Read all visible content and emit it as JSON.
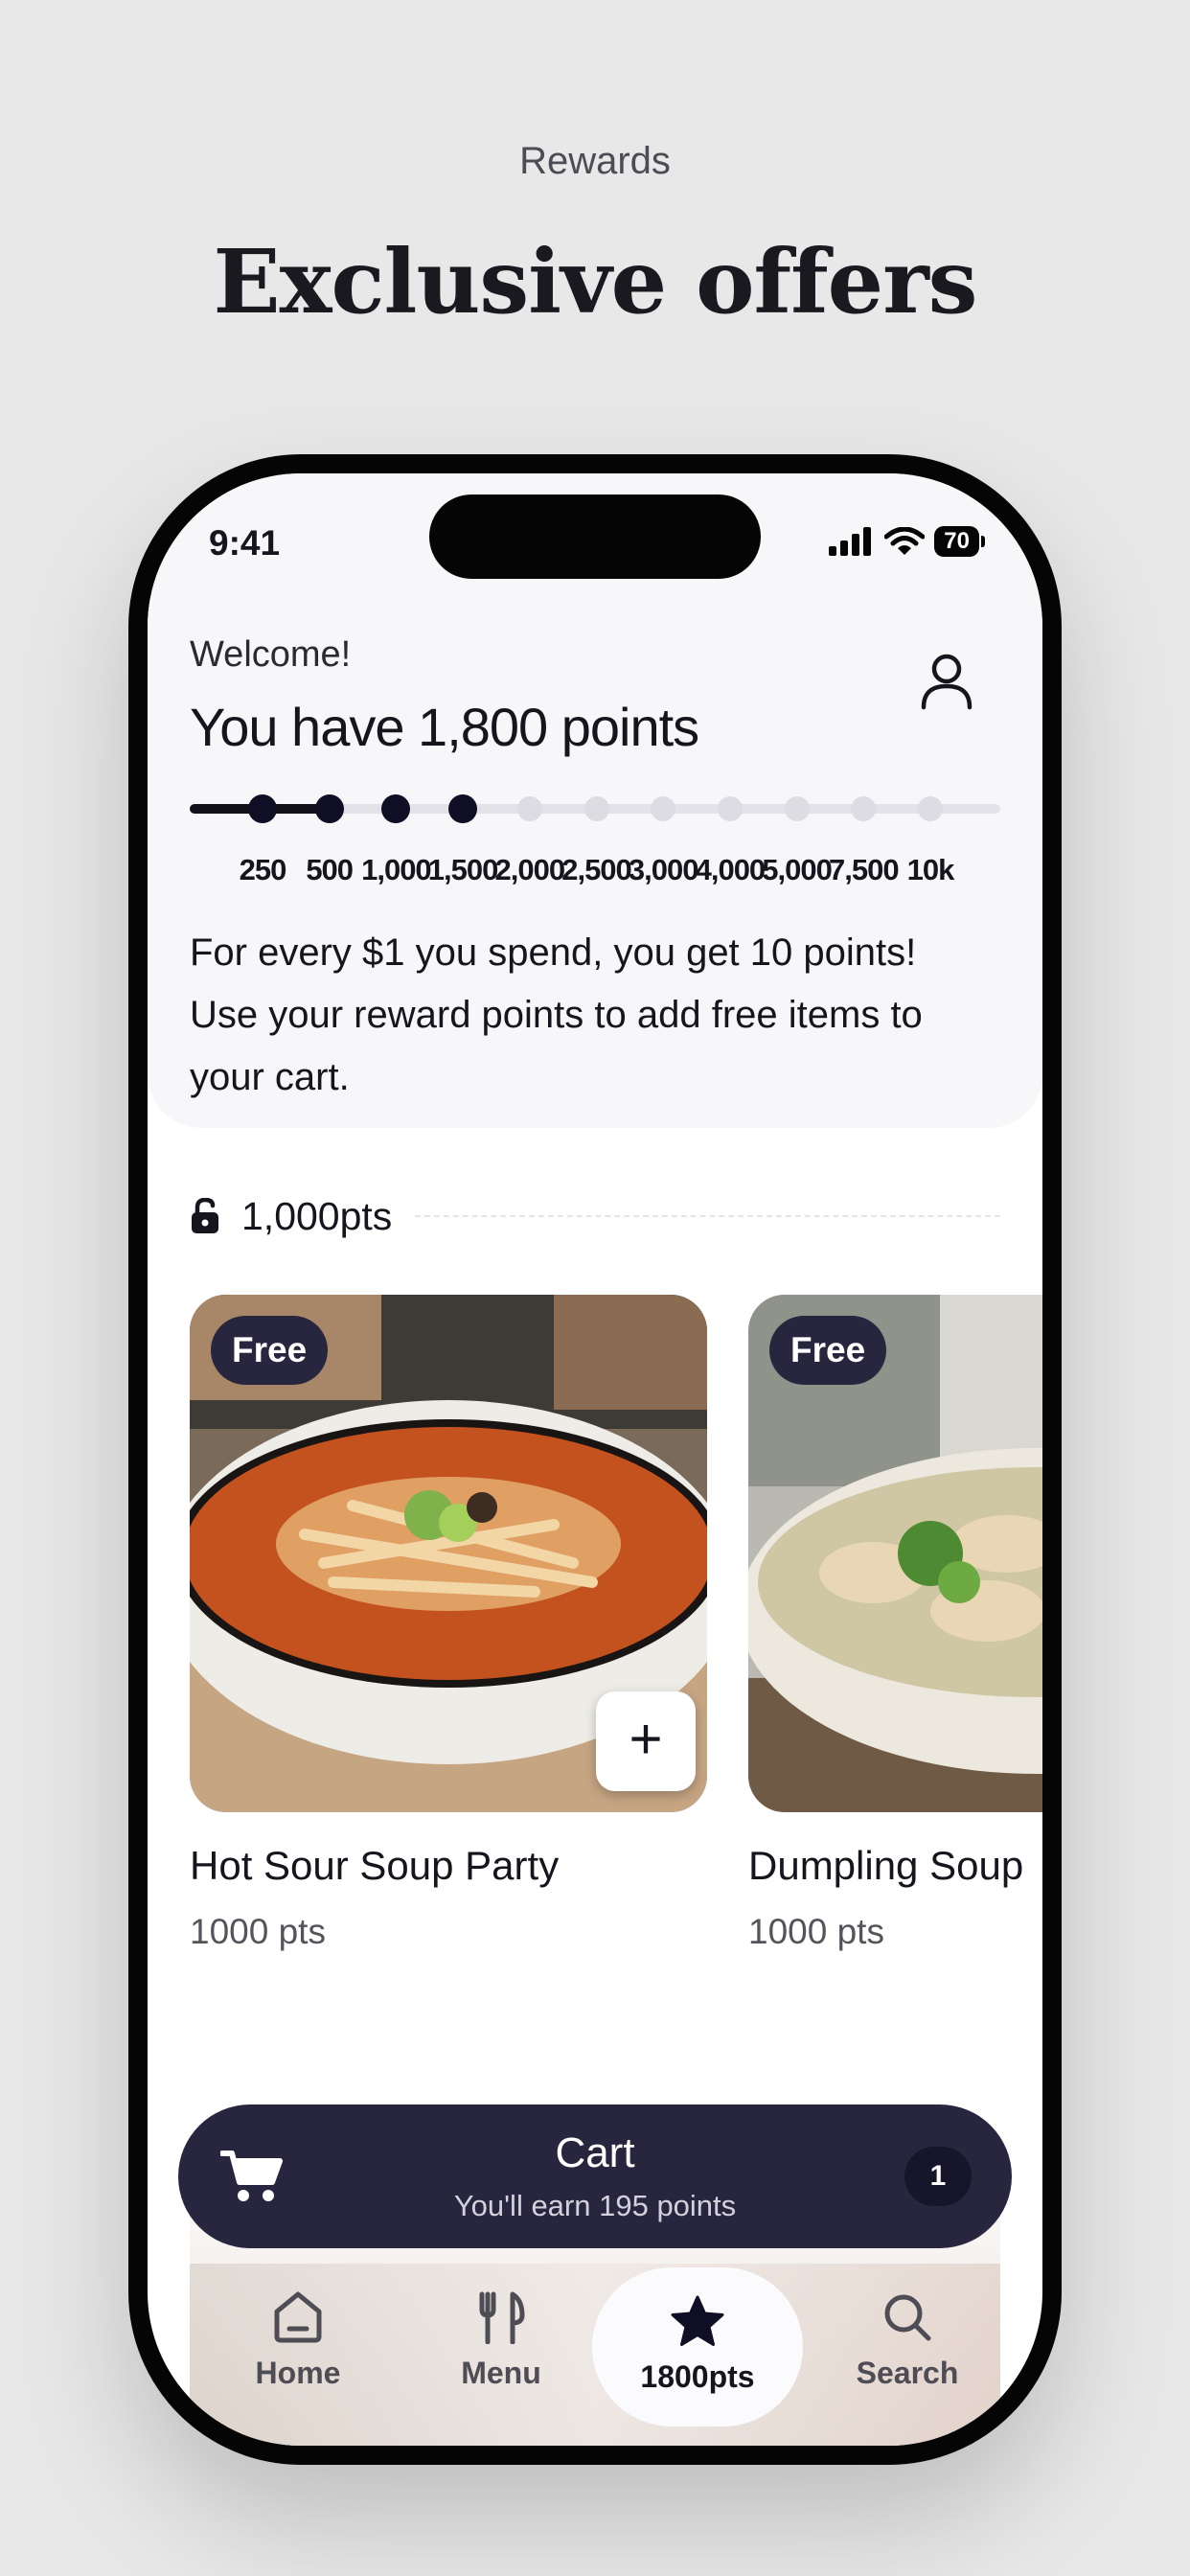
{
  "page": {
    "kicker": "Rewards",
    "headline": "Exclusive offers"
  },
  "status_bar": {
    "time": "9:41",
    "battery": "70"
  },
  "header": {
    "welcome": "Welcome!",
    "points_title": "You have 1,800 points",
    "progress_fraction": 0.19,
    "milestones": [
      "250",
      "500",
      "1,000",
      "1,500",
      "2,000",
      "2,500",
      "3,000",
      "4,000",
      "5,000",
      "7,500",
      "10k"
    ],
    "reached_milestones": 4,
    "info_text": "For every $1 you spend, you get 10 points! Use your reward points to add free items to your cart."
  },
  "tier": {
    "label": "1,000pts",
    "icon": "unlock-icon"
  },
  "items": [
    {
      "badge": "Free",
      "name": "Hot Sour Soup Party",
      "points": "1000 pts",
      "add_label": "+"
    },
    {
      "badge": "Free",
      "name": "Dumpling Soup",
      "points": "1000 pts"
    }
  ],
  "cart": {
    "title": "Cart",
    "subtitle": "You'll earn 195 points",
    "count": "1"
  },
  "tabs": [
    {
      "label": "Home",
      "icon": "home-icon"
    },
    {
      "label": "Menu",
      "icon": "utensils-icon"
    },
    {
      "label": "1800pts",
      "icon": "star-icon",
      "active": true
    },
    {
      "label": "Search",
      "icon": "search-icon"
    }
  ],
  "colors": {
    "background": "#e8e8e8",
    "accent_dark": "#28263e",
    "progress_on": "#0f0e24",
    "progress_off": "#dcdce2"
  }
}
